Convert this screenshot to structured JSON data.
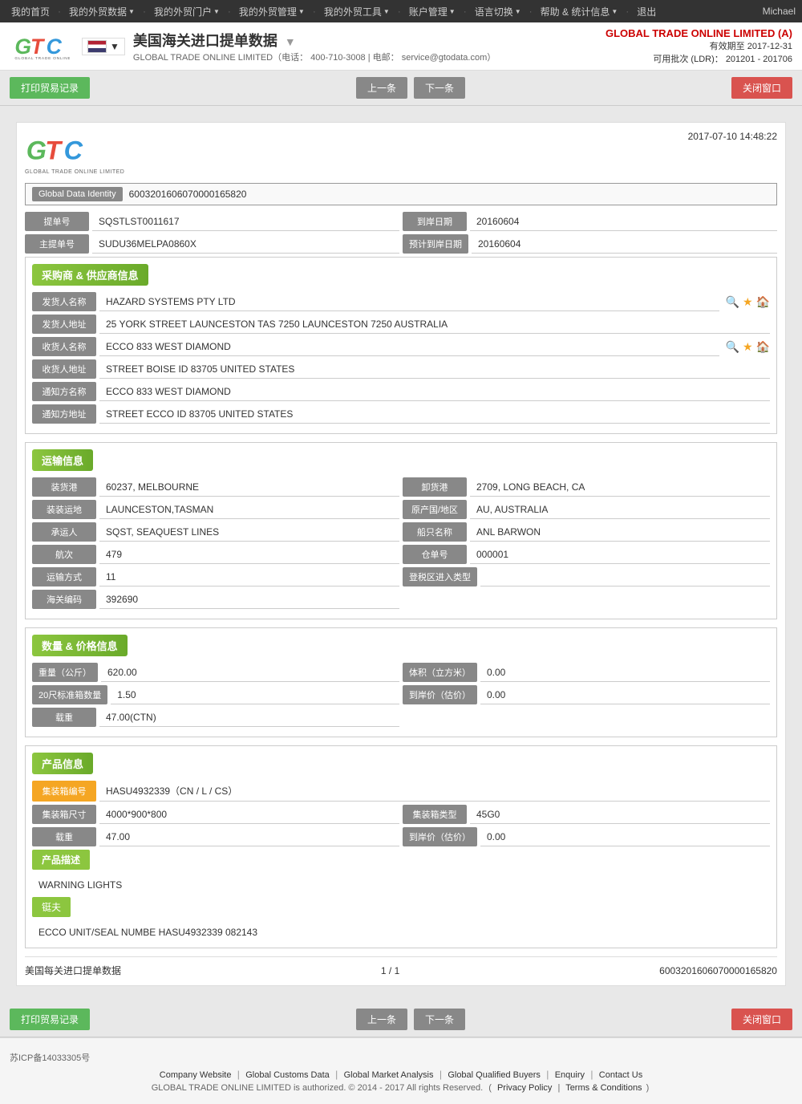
{
  "nav": {
    "items": [
      {
        "label": "我的首页",
        "has_arrow": false
      },
      {
        "label": "我的外贸数据",
        "has_arrow": true
      },
      {
        "label": "我的外贸门户",
        "has_arrow": true
      },
      {
        "label": "我的外贸管理",
        "has_arrow": true
      },
      {
        "label": "我的外贸工具",
        "has_arrow": true
      },
      {
        "label": "账户管理",
        "has_arrow": true
      },
      {
        "label": "语言切换",
        "has_arrow": true
      },
      {
        "label": "帮助 & 统计信息",
        "has_arrow": true
      },
      {
        "label": "退出",
        "has_arrow": false
      }
    ],
    "user": "Michael"
  },
  "header": {
    "title": "美国海关进口提单数据",
    "subtitle_company": "GLOBAL TRADE ONLINE LIMITED",
    "subtitle_phone": "400-710-3008",
    "subtitle_email": "service@gtodata.com",
    "company_name": "GLOBAL TRADE ONLINE LIMITED (A)",
    "validity_label": "有效期至",
    "validity_date": "2017-12-31",
    "ldr_label": "可用批次 (LDR)：",
    "ldr_value": "201201 - 201706"
  },
  "toolbar": {
    "btn_trade_record": "打印贸易记录",
    "btn_prev": "上一条",
    "btn_next": "下一条",
    "btn_close": "关闭窗口"
  },
  "document": {
    "datetime": "2017-07-10 14:48:22",
    "identity_label": "Global Data Identity",
    "identity_value": "6003201606070000165820",
    "bill_no_label": "提单号",
    "bill_no_value": "SQSTLST0011617",
    "arrival_date_label": "到岸日期",
    "arrival_date_value": "20160604",
    "master_bill_label": "主提单号",
    "master_bill_value": "SUDU36MELPA0860X",
    "estimated_arrival_label": "预计到岸日期",
    "estimated_arrival_value": "20160604"
  },
  "buyer_supplier": {
    "section_title": "采购商 & 供应商信息",
    "shipper_name_label": "发货人名称",
    "shipper_name_value": "HAZARD SYSTEMS PTY LTD",
    "shipper_addr_label": "发货人地址",
    "shipper_addr_value": "25 YORK STREET LAUNCESTON TAS 7250 LAUNCESTON 7250 AUSTRALIA",
    "consignee_name_label": "收货人名称",
    "consignee_name_value": "ECCO 833 WEST DIAMOND",
    "consignee_addr_label": "收货人地址",
    "consignee_addr_value": "STREET BOISE ID 83705 UNITED STATES",
    "notify_name_label": "通知方名称",
    "notify_name_value": "ECCO 833 WEST DIAMOND",
    "notify_addr_label": "通知方地址",
    "notify_addr_value": "STREET ECCO ID 83705 UNITED STATES"
  },
  "transport": {
    "section_title": "运输信息",
    "loading_port_label": "装货港",
    "loading_port_value": "60237, MELBOURNE",
    "discharge_port_label": "卸货港",
    "discharge_port_value": "2709, LONG BEACH, CA",
    "loading_place_label": "装装运地",
    "loading_place_value": "LAUNCESTON,TASMAN",
    "origin_label": "原产国/地区",
    "origin_value": "AU, AUSTRALIA",
    "carrier_label": "承运人",
    "carrier_value": "SQST, SEAQUEST LINES",
    "vessel_label": "船只名称",
    "vessel_value": "ANL BARWON",
    "voyage_label": "航次",
    "voyage_value": "479",
    "manifest_label": "仓单号",
    "manifest_value": "000001",
    "transport_mode_label": "运输方式",
    "transport_mode_value": "11",
    "trade_zone_label": "登税区进入类型",
    "customs_code_label": "海关编码",
    "customs_code_value": "392690"
  },
  "quantity_price": {
    "section_title": "数量 & 价格信息",
    "weight_label": "重量（公斤）",
    "weight_value": "620.00",
    "volume_label": "体积（立方米）",
    "volume_value": "0.00",
    "container_20_label": "20尺标准箱数量",
    "container_20_value": "1.50",
    "arrival_price_label": "到岸价（估价）",
    "arrival_price_value": "0.00",
    "quantity_label": "载重",
    "quantity_value": "47.00(CTN)"
  },
  "product": {
    "section_title": "产品信息",
    "container_no_label": "集装箱编号",
    "container_no_value": "HASU4932339（CN / L / CS）",
    "container_size_label": "集装箱尺寸",
    "container_size_value": "4000*900*800",
    "container_type_label": "集装箱类型",
    "container_type_value": "45G0",
    "quantity_label": "载重",
    "quantity_value": "47.00",
    "arrival_price_label": "到岸价（估价）",
    "arrival_price_value": "0.00",
    "desc_label": "产品描述",
    "desc_value": "WARNING LIGHTS",
    "seal_label": "铤夫",
    "seal_value": "ECCO UNIT/SEAL NUMBE HASU4932339 082143"
  },
  "doc_footer": {
    "title": "美国每关进口提单数据",
    "pagination": "1 / 1",
    "id": "6003201606070000165820"
  },
  "page_footer": {
    "links": [
      {
        "label": "Company Website"
      },
      {
        "label": "Global Customs Data"
      },
      {
        "label": "Global Market Analysis"
      },
      {
        "label": "Global Qualified Buyers"
      },
      {
        "label": "Enquiry"
      },
      {
        "label": "Contact Us"
      }
    ],
    "copyright": "GLOBAL TRADE ONLINE LIMITED is authorized. © 2014 - 2017 All rights Reserved.",
    "privacy_link": "Privacy Policy",
    "terms_link": "Terms & Conditions",
    "icp": "苏ICP备14033305号"
  }
}
